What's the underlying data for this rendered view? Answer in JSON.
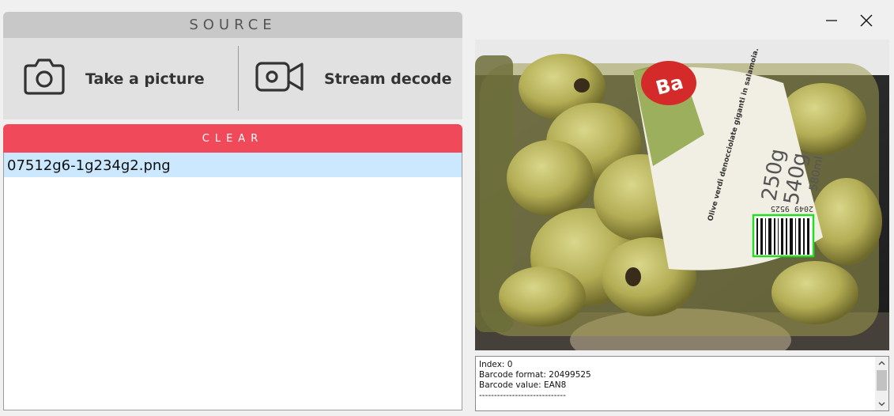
{
  "source": {
    "header": "SOURCE",
    "take_picture_label": "Take a picture",
    "stream_decode_label": "Stream decode"
  },
  "clear_label": "CLEAR",
  "files": [
    "07512g6-1g234g2.png"
  ],
  "result": {
    "lines": [
      "Index: 0",
      "Barcode format: 20499525",
      "Barcode value: EAN8",
      "-----------------------------"
    ]
  },
  "image": {
    "brand": "Ba",
    "product_title": "Olive verdi denocciolate giganti in salamoia.",
    "weight_1": "250g",
    "weight_2": "540g",
    "volume": "580ml",
    "barcode_digits": "2049 9525"
  },
  "colors": {
    "clear": "#f04a5a",
    "selection": "#cce8ff",
    "detection": "#22dd22"
  }
}
